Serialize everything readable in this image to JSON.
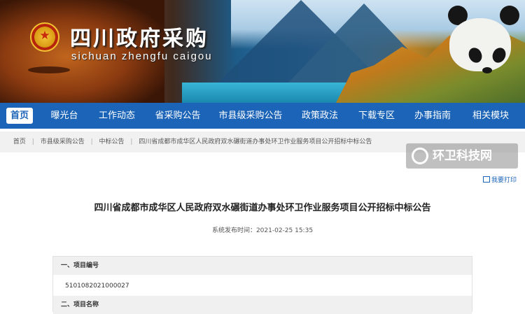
{
  "logo": {
    "title": "四川政府采购",
    "subtitle": "sichuan zhengfu caigou"
  },
  "nav": {
    "items": [
      {
        "label": "首页",
        "active": true
      },
      {
        "label": "曝光台"
      },
      {
        "label": "工作动态"
      },
      {
        "label": "省采购公告"
      },
      {
        "label": "市县级采购公告"
      },
      {
        "label": "政策政法"
      },
      {
        "label": "下载专区"
      },
      {
        "label": "办事指南"
      },
      {
        "label": "相关模块"
      }
    ]
  },
  "breadcrumb": {
    "items": [
      "首页",
      "市县级采购公告",
      "中标公告",
      "四川省成都市成华区人民政府双水碾街道办事处环卫作业服务项目公开招标中标公告"
    ]
  },
  "watermark": {
    "text": "环卫科技网"
  },
  "print_link": "我要打印",
  "document": {
    "title": "四川省成都市成华区人民政府双水碾街道办事处环卫作业服务项目公开招标中标公告",
    "publish_time": "系统发布时间：2021-02-25 15:35",
    "sections": [
      {
        "heading": "一、项目编号",
        "value": "5101082021000027"
      },
      {
        "heading": "二、项目名称",
        "value": ""
      }
    ]
  },
  "colors": {
    "nav_bg": "#1b64b7",
    "breadcrumb_bg": "#f1f1f1",
    "section_bg": "#f0f0f0"
  }
}
